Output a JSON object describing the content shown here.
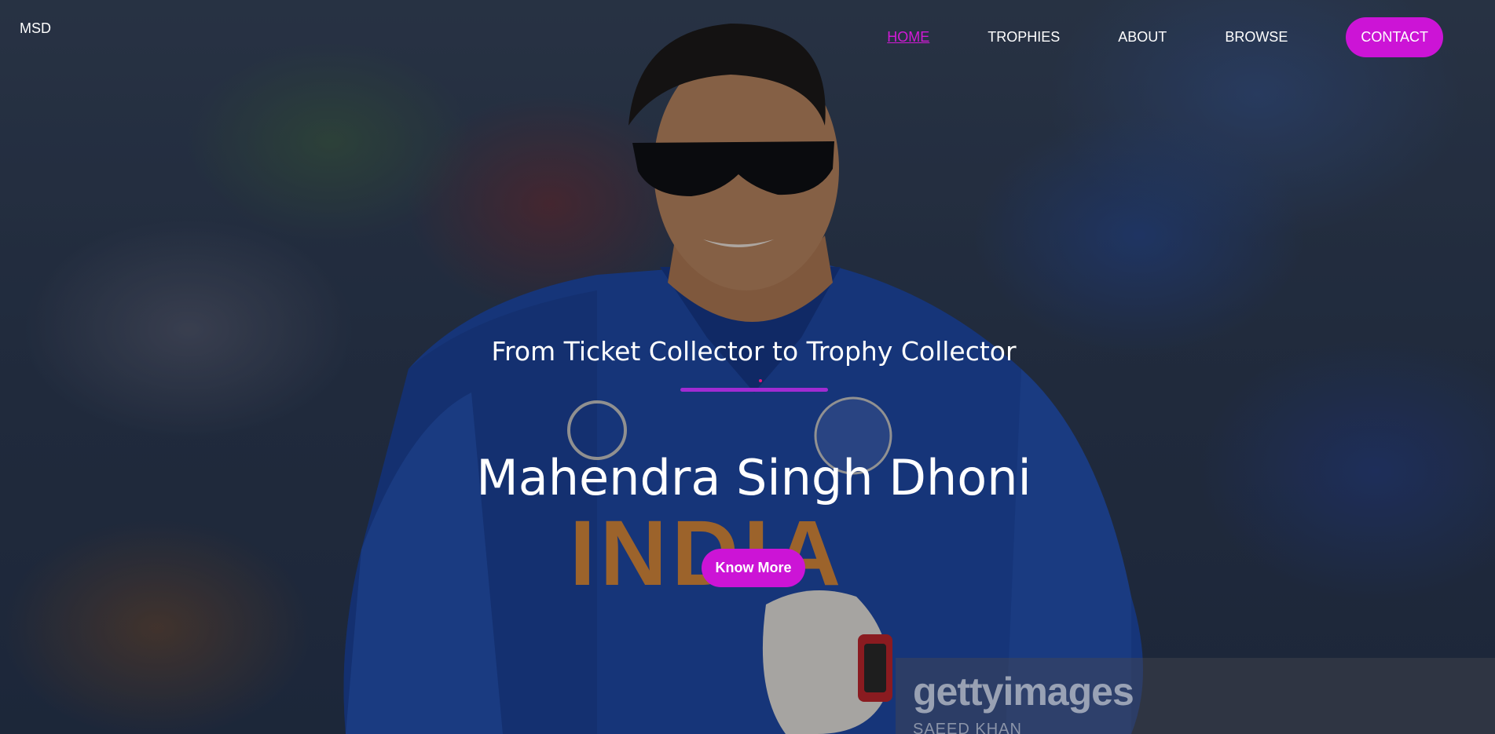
{
  "brand": {
    "logo": "MSD"
  },
  "nav": {
    "items": [
      {
        "label": "HOME",
        "active": true
      },
      {
        "label": "TROPHIES",
        "active": false
      },
      {
        "label": "ABOUT",
        "active": false
      },
      {
        "label": "BROWSE",
        "active": false
      }
    ],
    "contact_label": "CONTACT"
  },
  "hero": {
    "tagline": "From Ticket Collector to Trophy Collector",
    "title": "Mahendra Singh Dhoni",
    "cta_label": "Know More",
    "jersey_text": "INDIA",
    "watermark_logo": "gettyimages",
    "watermark_credit": "SAEED KHAN"
  },
  "colors": {
    "accent": "#cc14d6",
    "nav_active": "#d21ad6",
    "divider": "#a12bd2",
    "text": "#ffffff"
  },
  "icons": [
    "player-photo",
    "getty-watermark"
  ]
}
